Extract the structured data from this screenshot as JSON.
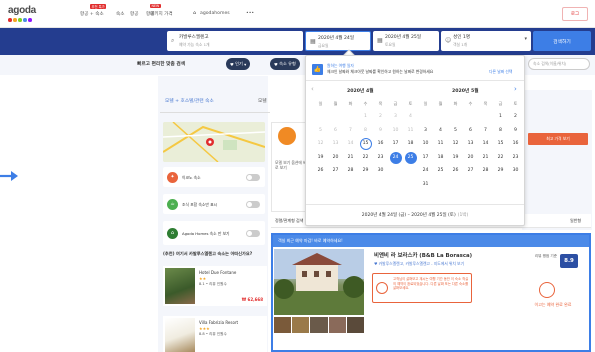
{
  "nav": {
    "logo": "agoda",
    "logo_colors": [
      "#e12d2d",
      "#f5a623",
      "#7ed321",
      "#4a90e2",
      "#9013fe"
    ],
    "items": [
      {
        "label": "항공 + 숙소",
        "badge": "추천 특가"
      },
      {
        "label": "숙소"
      },
      {
        "label": "항공"
      },
      {
        "label": "항공"
      },
      {
        "label": "패키지 가격",
        "badge": "NEW"
      },
      {
        "label": "agodahomes"
      },
      {
        "label": "•••"
      }
    ],
    "right_button": "로그"
  },
  "search": {
    "destination": "카발루스엘렌고",
    "destination_sub": "예약 가능 숙소 1개",
    "checkin": "2020년 4월 24일",
    "checkin_day": "금요일",
    "checkout": "2020년 4월 25일",
    "checkout_day": "토요일",
    "guests": "성인 1명",
    "rooms": "객실 1개",
    "button": "검색하기"
  },
  "filters": {
    "label": "빠르고 편리한 맞춤 검색",
    "pill_popular": "인기",
    "pill_other": "숙소 유형",
    "search_placeholder": "숙소 검색(이름/위치)"
  },
  "left": {
    "tab_left": "모텔 + 호스텔/관련 숙소",
    "tab_right": "모텔",
    "toggles": [
      {
        "label": "이코노 숙소",
        "color": "#e9643c",
        "icon": "tag-icon"
      },
      {
        "label": "조식 포함 숙소만 표시",
        "color": "#4caf50",
        "icon": "breakfast-icon"
      },
      {
        "label": "Agoda Homes 숙소 만 보기",
        "color": "#2e7d32",
        "icon": "home-icon"
      }
    ],
    "rec_title": "(추천) 여기서 카발루스엘렌고 숙소는 어떠신가요?",
    "hotels": [
      {
        "name": "Hotel Due Fontane",
        "stars": "★★",
        "score": "8.1 • 리뷰 인원수",
        "price": "₩ 62,668"
      },
      {
        "name": "Villa Fabrizia Resort",
        "stars": "★★★",
        "score": "8.8 • 리뷰 인원수",
        "price": ""
      }
    ]
  },
  "main": {
    "card_text": "모델 보기 옵션에 바로 보기",
    "red_chip": "최고 가격 보기",
    "sort_left": "정렬/관계형 검색",
    "sort_right": "일반형",
    "listing_banner": "객실 최근 예약 마감! 바로 예약하세요!",
    "listing_name": "비앤비 라 보라스카 (B&B La Borasca)",
    "listing_loc": "♥ 카발루스엘렌고, 카발루스엘렌고 - 지도에서 위치 보기",
    "notice": "고객님이 살펴보고 계시는 여행 기간 동안 이 숙소 객실의 예약이 완료되었습니다. 다른 날짜 또는 다른 숙소를 살펴보세요.",
    "score_label": "리뷰 평점 기준",
    "score": "8.9",
    "right_text": "이고는 예약 완료 완료"
  },
  "calendar": {
    "header_title": "원하는 여행 일자",
    "header_text": "체크인 날짜와 체크아웃 날짜를 확인하고 원하는 날짜로 변경하세요",
    "header_link": "다른 날짜 선택",
    "weekdays": [
      "일",
      "월",
      "화",
      "수",
      "목",
      "금",
      "토"
    ],
    "months": [
      {
        "title": "2020년 4월",
        "weeks": [
          [
            "",
            "",
            "",
            "1",
            "2",
            "3",
            "4"
          ],
          [
            "5",
            "6",
            "7",
            "8",
            "9",
            "10",
            "11"
          ],
          [
            "12",
            "13",
            "14",
            "15",
            "16",
            "17",
            "18"
          ],
          [
            "19",
            "20",
            "21",
            "22",
            "23",
            "24",
            "25"
          ],
          [
            "26",
            "27",
            "28",
            "29",
            "30",
            "",
            ""
          ]
        ],
        "past_until": 14,
        "today": "15",
        "selected": [
          "24",
          "25"
        ]
      },
      {
        "title": "2020년 5월",
        "weeks": [
          [
            "",
            "",
            "",
            "",
            "",
            "1",
            "2"
          ],
          [
            "3",
            "4",
            "5",
            "6",
            "7",
            "8",
            "9"
          ],
          [
            "10",
            "11",
            "12",
            "13",
            "14",
            "15",
            "16"
          ],
          [
            "17",
            "18",
            "19",
            "20",
            "21",
            "22",
            "23"
          ],
          [
            "24",
            "25",
            "26",
            "27",
            "28",
            "29",
            "30"
          ],
          [
            "31",
            "",
            "",
            "",
            "",
            "",
            ""
          ]
        ]
      }
    ],
    "footer_range": "2020년 4월 24일 (금) – 2020년 4월 25일 (토)",
    "footer_nights": "(1박)"
  }
}
